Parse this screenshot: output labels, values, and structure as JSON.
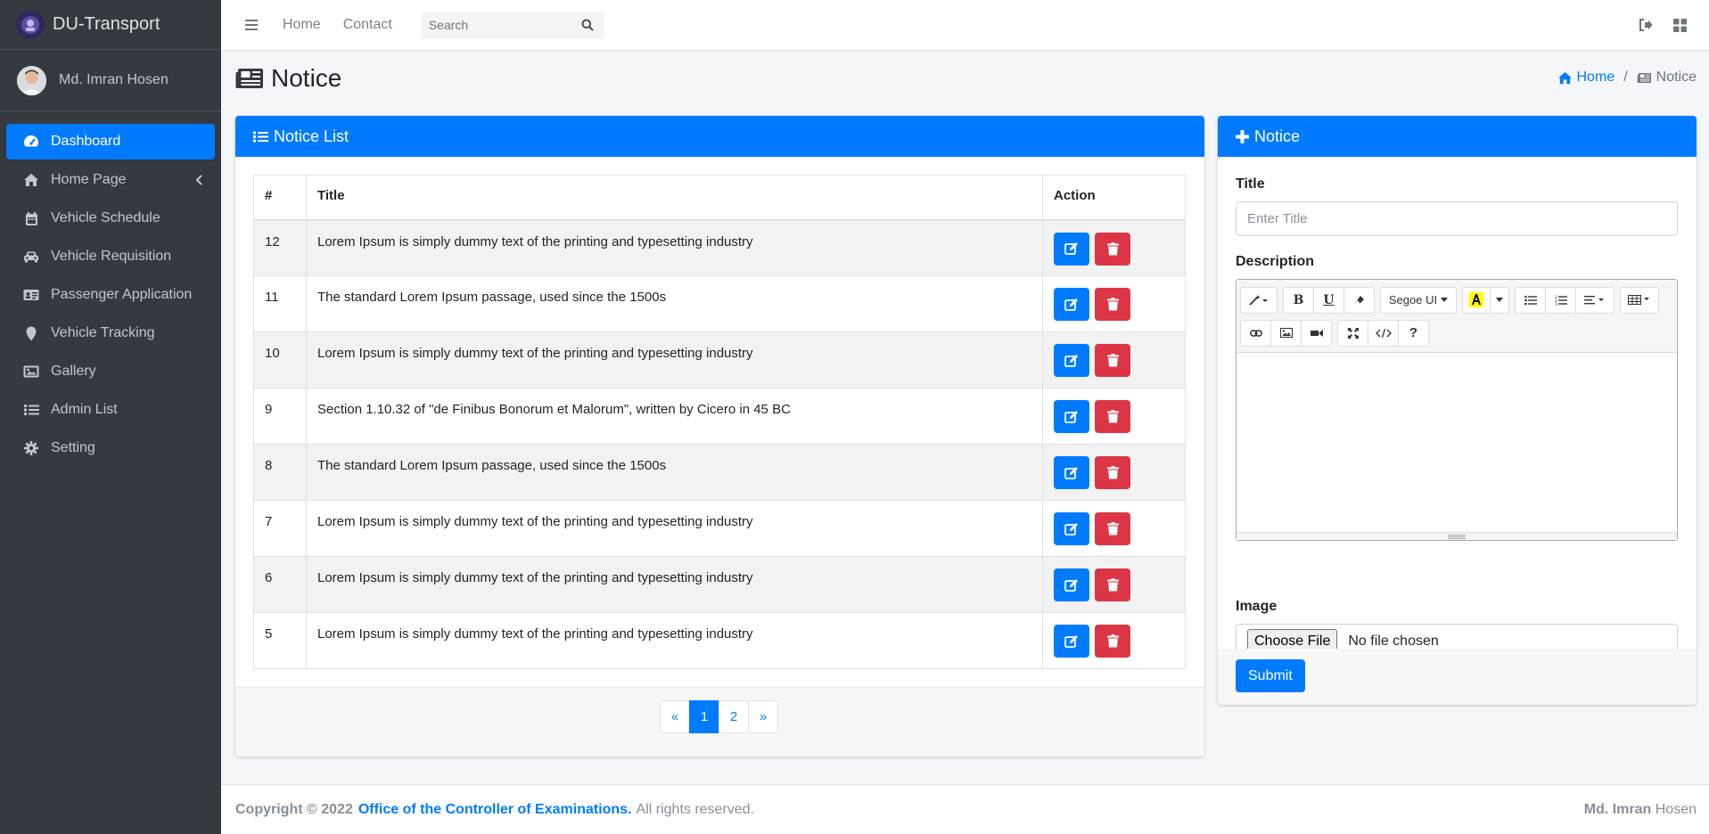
{
  "brand": {
    "name": "DU-Transport"
  },
  "user": {
    "name": "Md. Imran Hosen"
  },
  "sidebar": {
    "items": [
      {
        "label": "Dashboard",
        "icon": "tachometer-icon",
        "active": true
      },
      {
        "label": "Home Page",
        "icon": "home-icon",
        "has_children": true
      },
      {
        "label": "Vehicle Schedule",
        "icon": "calendar-icon"
      },
      {
        "label": "Vehicle Requisition",
        "icon": "car-icon"
      },
      {
        "label": "Passenger Application",
        "icon": "id-card-icon"
      },
      {
        "label": "Vehicle Tracking",
        "icon": "map-marker-icon"
      },
      {
        "label": "Gallery",
        "icon": "image-icon"
      },
      {
        "label": "Admin List",
        "icon": "list-icon"
      },
      {
        "label": "Setting",
        "icon": "gear-icon"
      }
    ]
  },
  "navbar": {
    "links": [
      "Home",
      "Contact"
    ],
    "search": {
      "placeholder": "Search"
    }
  },
  "page": {
    "title": "Notice",
    "breadcrumb": {
      "home": "Home",
      "current": "Notice"
    }
  },
  "notice_list": {
    "header": "Notice List",
    "columns": [
      "#",
      "Title",
      "Action"
    ],
    "rows": [
      {
        "id": "12",
        "title": "Lorem Ipsum is simply dummy text of the printing and typesetting industry"
      },
      {
        "id": "11",
        "title": "The standard Lorem Ipsum passage, used since the 1500s"
      },
      {
        "id": "10",
        "title": "Lorem Ipsum is simply dummy text of the printing and typesetting industry"
      },
      {
        "id": "9",
        "title": "Section 1.10.32 of \"de Finibus Bonorum et Malorum\", written by Cicero in 45 BC"
      },
      {
        "id": "8",
        "title": "The standard Lorem Ipsum passage, used since the 1500s"
      },
      {
        "id": "7",
        "title": "Lorem Ipsum is simply dummy text of the printing and typesetting industry"
      },
      {
        "id": "6",
        "title": "Lorem Ipsum is simply dummy text of the printing and typesetting industry"
      },
      {
        "id": "5",
        "title": "Lorem Ipsum is simply dummy text of the printing and typesetting industry"
      }
    ],
    "pagination": {
      "prev": "«",
      "pages": [
        "1",
        "2"
      ],
      "current": "1",
      "next": "»"
    }
  },
  "notice_form": {
    "header": "Notice",
    "title_label": "Title",
    "title_placeholder": "Enter Title",
    "description_label": "Description",
    "editor": {
      "font": "Segoe UI"
    },
    "image_label": "Image",
    "file_button": "Choose File",
    "file_status": "No file chosen",
    "submit": "Submit"
  },
  "footer": {
    "copyright": "Copyright © 2022",
    "org": "Office of the Controller of Examinations.",
    "rights": "All rights reserved.",
    "author_bold": "Md. Imran",
    "author_rest": "Hosen"
  },
  "colors": {
    "primary": "#007bff",
    "danger": "#dc3545",
    "sidebar": "#343a40"
  }
}
